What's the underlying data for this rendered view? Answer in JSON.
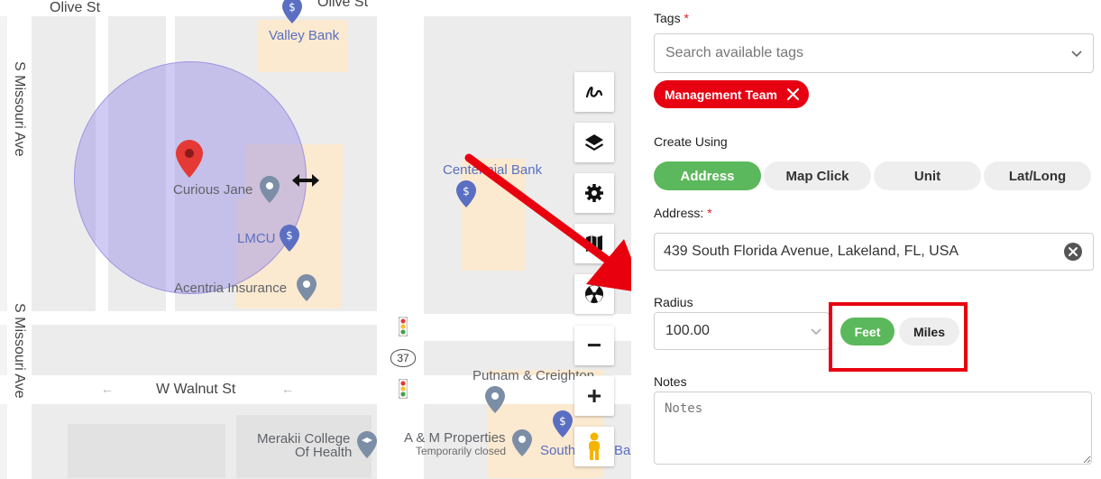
{
  "map": {
    "streets": {
      "olive_st_left": "Olive St",
      "olive_st_right": "Olive St",
      "s_missouri_ave_top": "S Missouri Ave",
      "s_missouri_ave_bottom": "S Missouri Ave",
      "w_walnut_st": "W Walnut St"
    },
    "pois": {
      "valley_bank": "Valley Bank",
      "curious_jane": "Curious Jane",
      "lmcu": "LMCU",
      "acentria": "Acentria Insurance",
      "centennial_bank": "Centennial Bank",
      "putnam": "Putnam & Creighton",
      "merakii_line1": "Merakii College",
      "merakii_line2": "Of Health",
      "am_properties": "A & M Properties",
      "am_properties_status": "Temporarily closed",
      "south_bank": "South",
      "south_bank_suffix": "Ba"
    },
    "route_shield": "37",
    "controls": {
      "draw_icon": "squiggle-draw-icon",
      "layers_icon": "layers-icon",
      "settings_icon": "gear-icon",
      "map_type_icon": "folded-map-icon",
      "radiation_icon": "radiation-icon",
      "zoom_out": "−",
      "zoom_in": "+",
      "street_view_icon": "pegman-icon"
    }
  },
  "form": {
    "tags": {
      "label": "Tags",
      "required_mark": "*",
      "placeholder": "Search available tags",
      "selected": [
        {
          "label": "Management Team"
        }
      ]
    },
    "create_using": {
      "label": "Create Using",
      "options": [
        "Address",
        "Map Click",
        "Unit",
        "Lat/Long"
      ],
      "selected": "Address"
    },
    "address": {
      "label": "Address:",
      "required_mark": "*",
      "value": "439 South Florida Avenue, Lakeland, FL, USA"
    },
    "radius": {
      "label": "Radius",
      "value": "100.00",
      "units": [
        "Feet",
        "Miles"
      ],
      "selected_unit": "Feet"
    },
    "notes": {
      "label": "Notes",
      "placeholder": "Notes"
    }
  },
  "colors": {
    "chip_red": "#e60012",
    "active_green": "#5cb85c",
    "annotation_red": "#e8000f",
    "radius_fill": "#968ce6"
  }
}
